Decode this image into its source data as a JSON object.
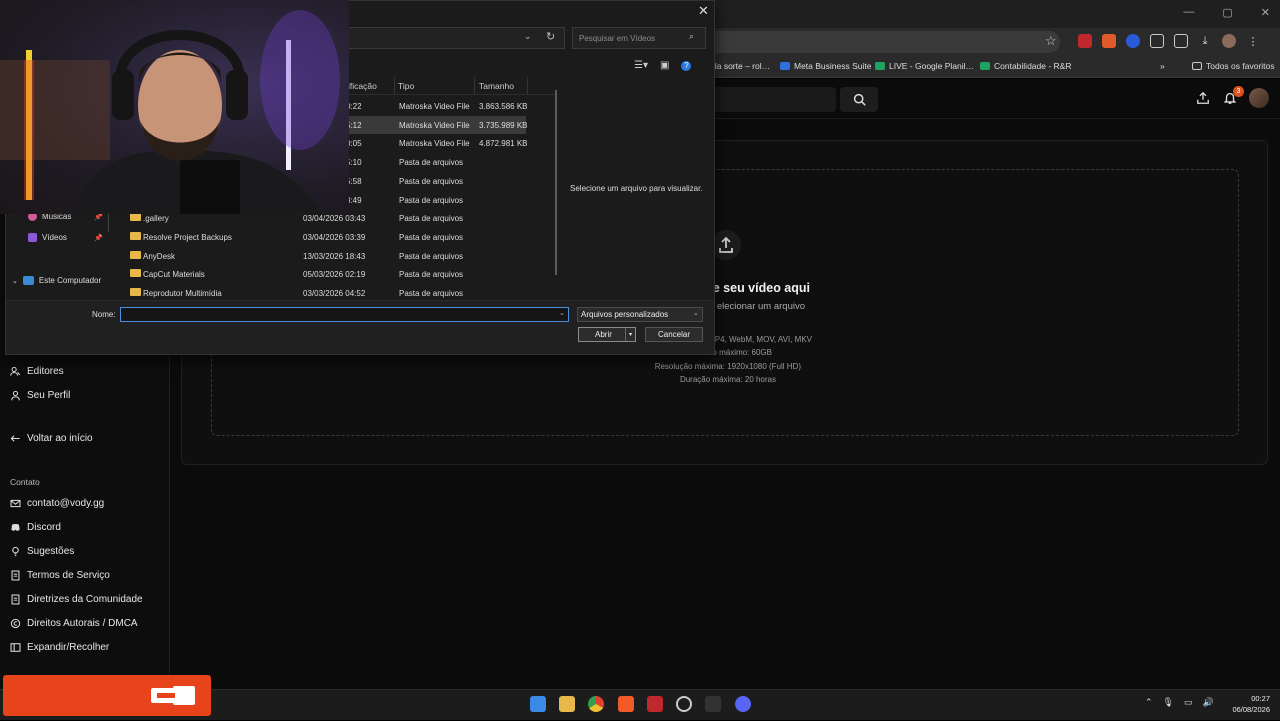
{
  "browser": {
    "bookmarks": [
      {
        "label": "da sorte – rol…",
        "color": "#2d2d2d"
      },
      {
        "label": "Meta Business Suite",
        "color": "#2f6fe0"
      },
      {
        "label": "LIVE - Google Planil…",
        "color": "#1ea362"
      },
      {
        "label": "Contabilidade - R&R",
        "color": "#1ea362"
      }
    ],
    "all_bookmarks": "Todos os favoritos"
  },
  "header": {
    "notification_count": "3"
  },
  "sidebar": {
    "items_top": [
      {
        "label": "Editores",
        "icon": "users-icon"
      },
      {
        "label": "Seu Perfil",
        "icon": "user-icon"
      }
    ],
    "back": "Voltar ao início",
    "contact_label": "Contato",
    "contact_items": [
      {
        "label": "contato@vody.gg",
        "icon": "mail-icon"
      },
      {
        "label": "Discord",
        "icon": "discord-icon"
      },
      {
        "label": "Sugestões",
        "icon": "bulb-icon"
      },
      {
        "label": "Termos de Serviço",
        "icon": "doc-icon"
      },
      {
        "label": "Diretrizes da Comunidade",
        "icon": "doc-icon"
      },
      {
        "label": "Direitos Autorais / DMCA",
        "icon": "copyright-icon"
      },
      {
        "label": "Expandir/Recolher",
        "icon": "expand-icon"
      }
    ]
  },
  "dropzone": {
    "title": "te seu vídeo aqui",
    "subtitle": "elecionar um arquivo",
    "formats": "P4, WebM, MOV, AVI, MKV",
    "max_size": "Tamanho máximo: 60GB",
    "max_resolution": "Resolução máxima: 1920x1080 (Full HD)",
    "max_duration": "Duração máxima: 20 horas"
  },
  "dialog": {
    "search_placeholder": "Pesquisar em Vídeos",
    "columns": {
      "modified": "ificação",
      "type": "Tipo",
      "size": "Tamanho"
    },
    "preview_text": "Selecione um arquivo para visualizar.",
    "tree": [
      {
        "label": "Músicas",
        "color": "#d45a9a"
      },
      {
        "label": "Vídeos",
        "color": "#8a5ad8"
      },
      {
        "label": "Este Computador",
        "color": "#3a8ad8"
      }
    ],
    "files": [
      {
        "name": "",
        "modified": "0:22",
        "type": "Matroska Video File",
        "size": "3.863.586 KB",
        "folder": false,
        "selected": false
      },
      {
        "name": "",
        "modified": "5:12",
        "type": "Matroska Video File",
        "size": "3.735.989 KB",
        "folder": false,
        "selected": true
      },
      {
        "name": "",
        "modified": "0:05",
        "type": "Matroska Video File",
        "size": "4.872.981 KB",
        "folder": false,
        "selected": false
      },
      {
        "name": "",
        "modified": "5:10",
        "type": "Pasta de arquivos",
        "size": "",
        "folder": true,
        "selected": false
      },
      {
        "name": "",
        "modified": "5:58",
        "type": "Pasta de arquivos",
        "size": "",
        "folder": true,
        "selected": false
      },
      {
        "name": "",
        "modified": "3:49",
        "type": "Pasta de arquivos",
        "size": "",
        "folder": true,
        "selected": false
      },
      {
        "name": ".gallery",
        "modified": "03/04/2026 03:43",
        "type": "Pasta de arquivos",
        "size": "",
        "folder": true,
        "selected": false
      },
      {
        "name": "Resolve Project Backups",
        "modified": "03/04/2026 03:39",
        "type": "Pasta de arquivos",
        "size": "",
        "folder": true,
        "selected": false
      },
      {
        "name": "AnyDesk",
        "modified": "13/03/2026 18:43",
        "type": "Pasta de arquivos",
        "size": "",
        "folder": true,
        "selected": false
      },
      {
        "name": "CapCut Materials",
        "modified": "05/03/2026 02:19",
        "type": "Pasta de arquivos",
        "size": "",
        "folder": true,
        "selected": false
      },
      {
        "name": "Reprodutor Multimídia",
        "modified": "03/03/2026 04:52",
        "type": "Pasta de arquivos",
        "size": "",
        "folder": true,
        "selected": false
      }
    ],
    "name_label": "Nome:",
    "name_value": "",
    "filter": "Arquivos personalizados",
    "open": "Abrir",
    "cancel": "Cancelar"
  },
  "taskbar": {
    "time": "00:27",
    "date": "06/08/2026"
  },
  "colors": {
    "accent": "#e8441b",
    "folder": "#e8b84a"
  }
}
